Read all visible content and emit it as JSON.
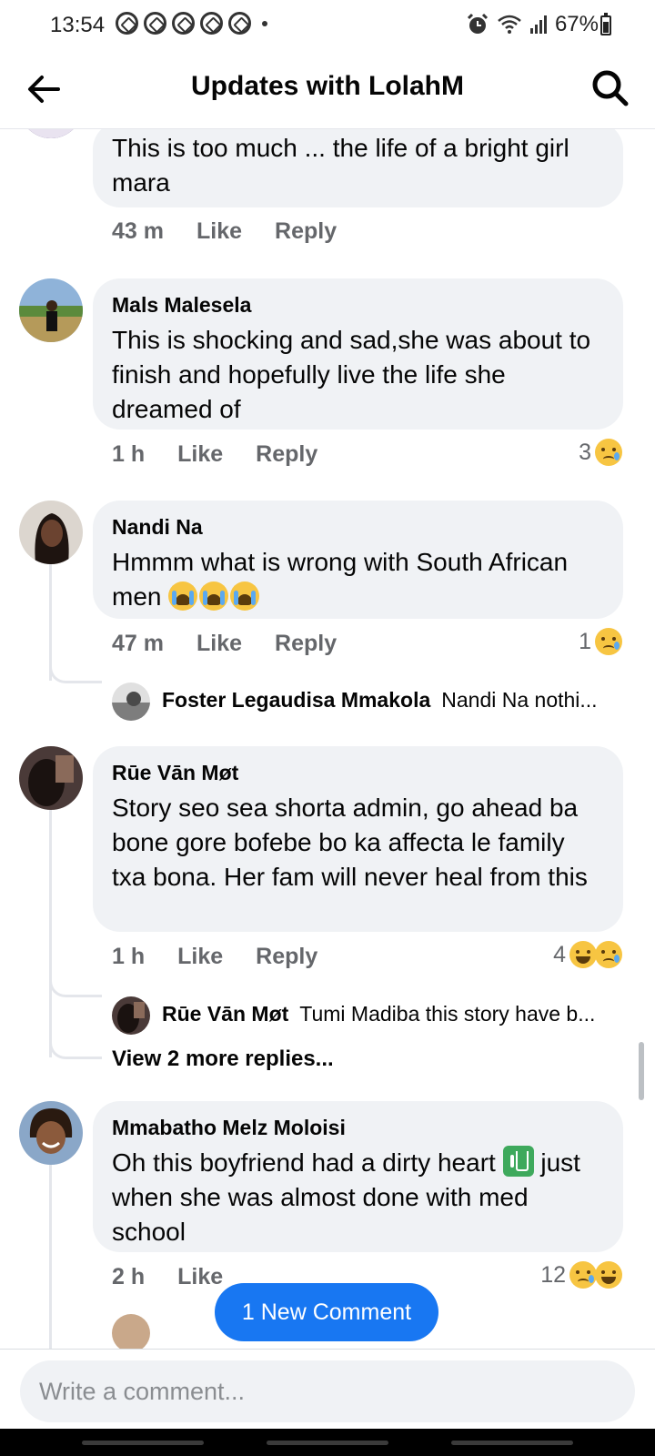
{
  "status_bar": {
    "time": "13:54",
    "battery": "67%"
  },
  "header": {
    "title": "Updates with LolahM"
  },
  "comments": [
    {
      "author": "",
      "text": "This is too much  ... the life of a bright girl  mara",
      "time": "43 m",
      "like": "Like",
      "reply": "Reply"
    },
    {
      "author": "Mals Malesela",
      "text": "This is shocking and sad,she was about to finish and hopefully live the life she dreamed of",
      "time": "1 h",
      "like": "Like",
      "reply": "Reply",
      "reaction_count": "3",
      "reaction_icons": [
        "sad-emoji"
      ]
    },
    {
      "author": "Nandi Na",
      "text": "Hmmm what is wrong with South African men",
      "text_emojis": [
        "crying-emoji",
        "crying-emoji",
        "crying-emoji"
      ],
      "time": "47 m",
      "like": "Like",
      "reply": "Reply",
      "reaction_count": "1",
      "reaction_icons": [
        "sad-emoji"
      ],
      "reply_preview": {
        "name": "Foster Legaudisa Mmakola",
        "text": "Nandi Na nothi..."
      }
    },
    {
      "author": "Rūe Vān Møt",
      "text": "Story seo sea shorta admin, go ahead ba bone gore bofebe bo ka affecta le family txa bona. Her fam will never heal from this",
      "time": "1 h",
      "like": "Like",
      "reply": "Reply",
      "reaction_count": "4",
      "reaction_icons": [
        "laugh-emoji",
        "sad-emoji"
      ],
      "reply_preview": {
        "name": "Rūe Vān Møt",
        "text": "Tumi Madiba this story have b..."
      },
      "view_more": "View 2 more replies..."
    },
    {
      "author": "Mmabatho Melz Moloisi",
      "text_before": "Oh this boyfriend had a dirty heart",
      "text_after": "just when she was almost done with med school",
      "inline_icon": "trash-emoji",
      "time": "2 h",
      "like": "Like",
      "reaction_count": "12",
      "reaction_icons": [
        "sad-emoji",
        "laugh-emoji"
      ]
    }
  ],
  "new_comment_pill": "1 New Comment",
  "composer": {
    "placeholder": "Write a comment..."
  }
}
